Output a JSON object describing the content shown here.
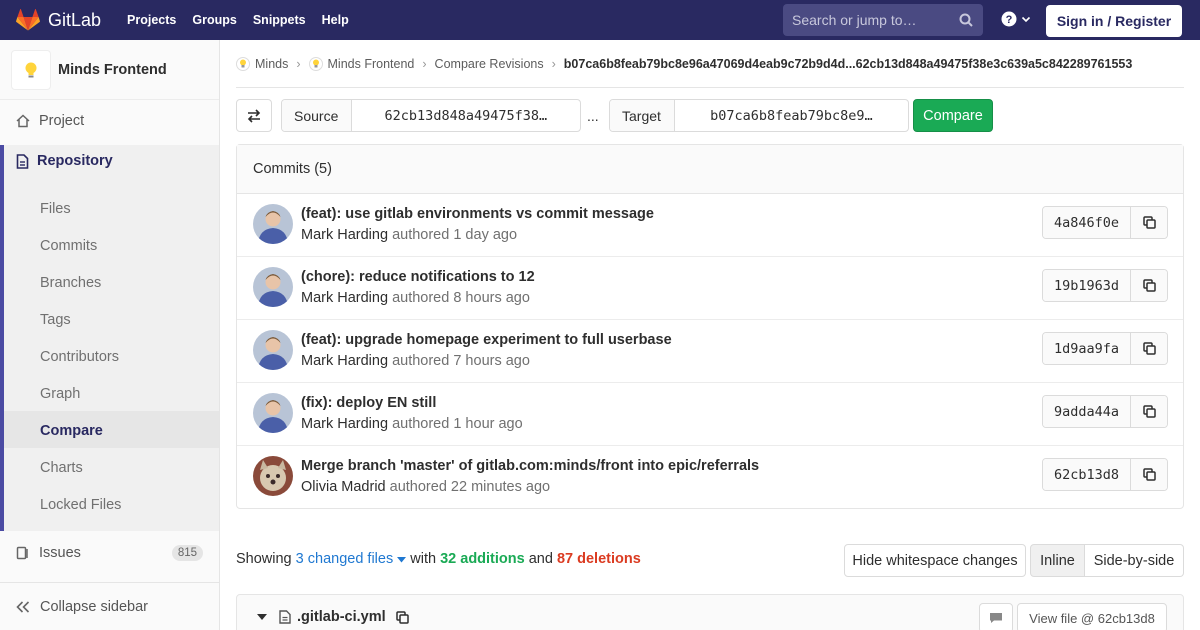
{
  "navbar": {
    "brand": "GitLab",
    "links": [
      "Projects",
      "Groups",
      "Snippets",
      "Help"
    ],
    "search_placeholder": "Search or jump to…",
    "signin_label": "Sign in / Register",
    "bg_color": "#292961"
  },
  "sidebar": {
    "project_name": "Minds Frontend",
    "project_label": "Project",
    "repository_label": "Repository",
    "repo_items": [
      "Files",
      "Commits",
      "Branches",
      "Tags",
      "Contributors",
      "Graph",
      "Compare",
      "Charts",
      "Locked Files"
    ],
    "active_item": "Compare",
    "issues_label": "Issues",
    "issues_count": "815",
    "collapse_label": "Collapse sidebar"
  },
  "breadcrumbs": {
    "items": [
      "Minds",
      "Minds Frontend",
      "Compare Revisions"
    ],
    "current": "b07ca6b8feab79bc8e96a47069d4eab9c72b9d4d...62cb13d848a49475f38e3c639a5c842289761553"
  },
  "compare": {
    "source_label": "Source",
    "source_value": "62cb13d848a49475f38…",
    "separator": "...",
    "target_label": "Target",
    "target_value": "b07ca6b8feab79bc8e9…",
    "compare_label": "Compare"
  },
  "commits": {
    "header": "Commits (5)",
    "items": [
      {
        "title": "(feat): use gitlab environments vs commit message",
        "author": "Mark Harding",
        "verb": "authored",
        "time": "1 day ago",
        "sha": "4a846f0e"
      },
      {
        "title": "(chore): reduce notifications to 12",
        "author": "Mark Harding",
        "verb": "authored",
        "time": "8 hours ago",
        "sha": "19b1963d"
      },
      {
        "title": "(feat): upgrade homepage experiment to full userbase",
        "author": "Mark Harding",
        "verb": "authored",
        "time": "7 hours ago",
        "sha": "1d9aa9fa"
      },
      {
        "title": "(fix): deploy EN still",
        "author": "Mark Harding",
        "verb": "authored",
        "time": "1 hour ago",
        "sha": "9adda44a"
      },
      {
        "title": "Merge branch 'master' of gitlab.com:minds/front into epic/referrals",
        "author": "Olivia Madrid",
        "verb": "authored",
        "time": "22 minutes ago",
        "sha": "62cb13d8"
      }
    ]
  },
  "diff": {
    "showing": "Showing",
    "files_link": "3 changed files",
    "with": "with",
    "additions": "32 additions",
    "and": "and",
    "deletions": "87 deletions",
    "hide_whitespace": "Hide whitespace changes",
    "inline": "Inline",
    "side_by_side": "Side-by-side",
    "file_name": ".gitlab-ci.yml",
    "view_file": "View file @ 62cb13d8"
  }
}
